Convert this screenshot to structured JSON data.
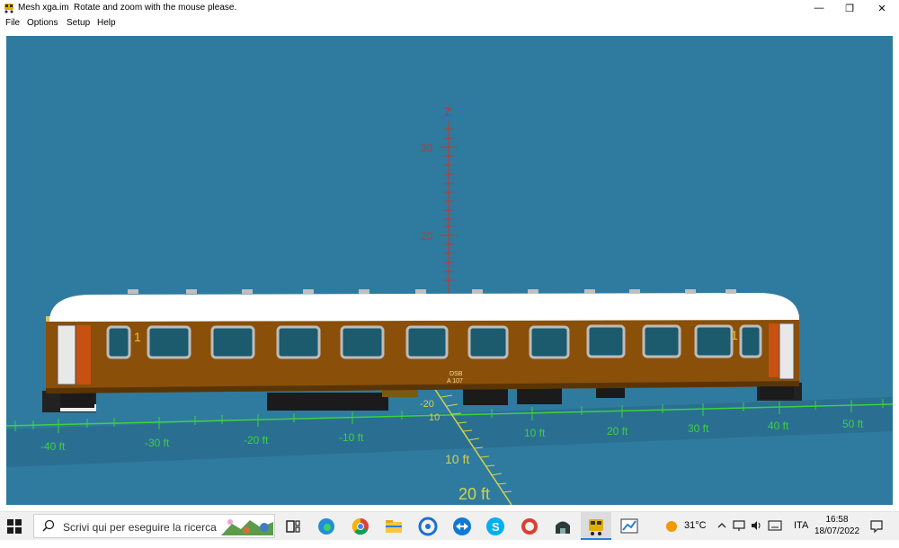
{
  "window": {
    "title": "Mesh xga.im",
    "message": "Rotate and zoom with the mouse please.",
    "minimize_glyph": "—",
    "maximize_glyph": "❐",
    "close_glyph": "✕"
  },
  "menu": {
    "items": [
      "File",
      "Options",
      "Setup",
      "Help"
    ]
  },
  "viewport": {
    "background": "#2f7a9f",
    "z_axis_label": "Z",
    "z_ticks": [
      "30",
      "20"
    ],
    "x_ticks": [
      "-40 ft",
      "-30 ft",
      "-20 ft",
      "-10 ft",
      "10 ft",
      "20 ft",
      "30 ft",
      "40 ft",
      "50 ft"
    ],
    "y_ticks": [
      "-20",
      "10",
      "10 ft",
      "20 ft"
    ],
    "car_marking_1": "DSB",
    "car_marking_2": "A 107",
    "class_number": "1",
    "car_color": "#8a4f08",
    "roof_color": "#ffffff",
    "x_axis_color": "#3cd23c",
    "y_axis_color": "#d4d24a",
    "z_axis_color": "#c0392b"
  },
  "taskbar": {
    "search_placeholder": "Scrivi qui per eseguire la ricerca",
    "icons": [
      "task-view-icon",
      "edge-icon",
      "chrome-icon",
      "file-explorer-icon",
      "app-circle-icon",
      "teamviewer-icon",
      "skype-icon",
      "ccleaner-icon",
      "app-dark-icon",
      "mesh-app-icon",
      "app-chart-icon"
    ],
    "weather_temp": "31°C",
    "language": "ITA",
    "time": "16:58",
    "date": "18/07/2022"
  }
}
